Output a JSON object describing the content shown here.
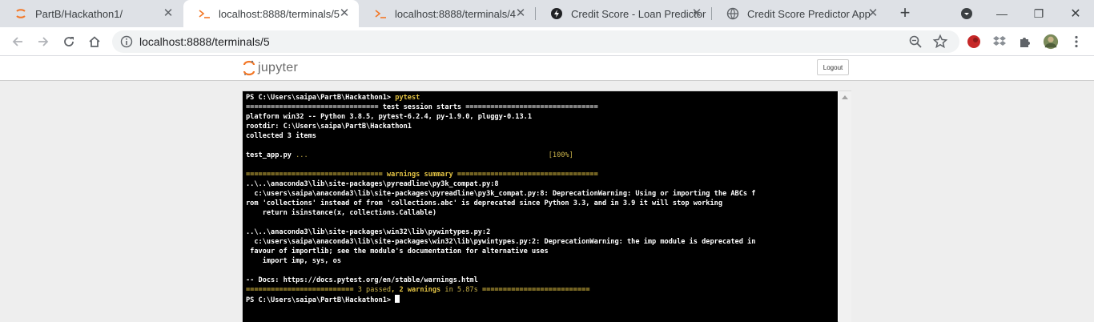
{
  "tabs": [
    {
      "title": "PartB/Hackathon1/",
      "icon": "jupyter-icon",
      "active": false
    },
    {
      "title": "localhost:8888/terminals/5",
      "icon": "terminal-icon",
      "active": true
    },
    {
      "title": "localhost:8888/terminals/4",
      "icon": "terminal-icon",
      "active": false
    },
    {
      "title": "Credit Score - Loan Predictor",
      "icon": "streamlit-icon",
      "active": false
    },
    {
      "title": "Credit Score Predictor App",
      "icon": "globe-icon",
      "active": false
    }
  ],
  "tab_close_glyph": "✕",
  "new_tab_glyph": "+",
  "window": {
    "minimize": "—",
    "maximize": "❐",
    "close": "✕"
  },
  "address": {
    "url": "localhost:8888/terminals/5"
  },
  "jupyter": {
    "logo_text": "jupyter",
    "logout_label": "Logout"
  },
  "terminal": {
    "lines": [
      {
        "segments": [
          {
            "t": "PS C:\\Users\\saipa\\PartB\\Hackathon1> "
          },
          {
            "t": "pytest",
            "c": "ylw"
          }
        ]
      },
      {
        "segments": [
          {
            "t": "================================ test session starts ================================"
          }
        ]
      },
      {
        "segments": [
          {
            "t": "platform win32 -- Python 3.8.5, pytest-6.2.4, py-1.9.0, pluggy-0.13.1"
          }
        ]
      },
      {
        "segments": [
          {
            "t": "rootdir: C:\\Users\\saipa\\PartB\\Hackathon1"
          }
        ]
      },
      {
        "segments": [
          {
            "t": "collected 3 items"
          }
        ]
      },
      {
        "segments": [
          {
            "t": ""
          }
        ]
      },
      {
        "segments": [
          {
            "t": "test_app.py "
          },
          {
            "t": "...",
            "c": "dim"
          },
          {
            "t": "                                                          "
          },
          {
            "t": "[100%]",
            "c": "dim"
          }
        ]
      },
      {
        "segments": [
          {
            "t": ""
          }
        ]
      },
      {
        "segments": [
          {
            "t": "================================= warnings summary ==================================",
            "c": "ylw"
          }
        ]
      },
      {
        "segments": [
          {
            "t": "..\\..\\anaconda3\\lib\\site-packages\\pyreadline\\py3k_compat.py:8"
          }
        ]
      },
      {
        "segments": [
          {
            "t": "  c:\\users\\saipa\\anaconda3\\lib\\site-packages\\pyreadline\\py3k_compat.py:8: DeprecationWarning: Using or importing the ABCs f"
          }
        ]
      },
      {
        "segments": [
          {
            "t": "rom 'collections' instead of from 'collections.abc' is deprecated since Python 3.3, and in 3.9 it will stop working"
          }
        ]
      },
      {
        "segments": [
          {
            "t": "    return isinstance(x, collections.Callable)"
          }
        ]
      },
      {
        "segments": [
          {
            "t": ""
          }
        ]
      },
      {
        "segments": [
          {
            "t": "..\\..\\anaconda3\\lib\\site-packages\\win32\\lib\\pywintypes.py:2"
          }
        ]
      },
      {
        "segments": [
          {
            "t": "  c:\\users\\saipa\\anaconda3\\lib\\site-packages\\win32\\lib\\pywintypes.py:2: DeprecationWarning: the imp module is deprecated in"
          }
        ]
      },
      {
        "segments": [
          {
            "t": " favour of importlib; see the module's documentation for alternative uses"
          }
        ]
      },
      {
        "segments": [
          {
            "t": "    import imp, sys, os"
          }
        ]
      },
      {
        "segments": [
          {
            "t": ""
          }
        ]
      },
      {
        "segments": [
          {
            "t": "-- Docs: https://docs.pytest.org/en/stable/warnings.html"
          }
        ]
      },
      {
        "segments": [
          {
            "t": "========================== ",
            "c": "ylw"
          },
          {
            "t": "3 passed",
            "c": "dim"
          },
          {
            "t": ", ",
            "c": "ylw"
          },
          {
            "t": "2 warnings",
            "c": "ylw"
          },
          {
            "t": " in 5.87s",
            "c": "dim"
          },
          {
            "t": " ==========================",
            "c": "ylw"
          }
        ]
      },
      {
        "segments": [
          {
            "t": "PS C:\\Users\\saipa\\PartB\\Hackathon1> "
          }
        ],
        "cursor": true
      }
    ]
  },
  "colors": {
    "accent_yellow": "#e5c545",
    "terminal_bg": "#000000",
    "jupyter_orange": "#f37726"
  }
}
